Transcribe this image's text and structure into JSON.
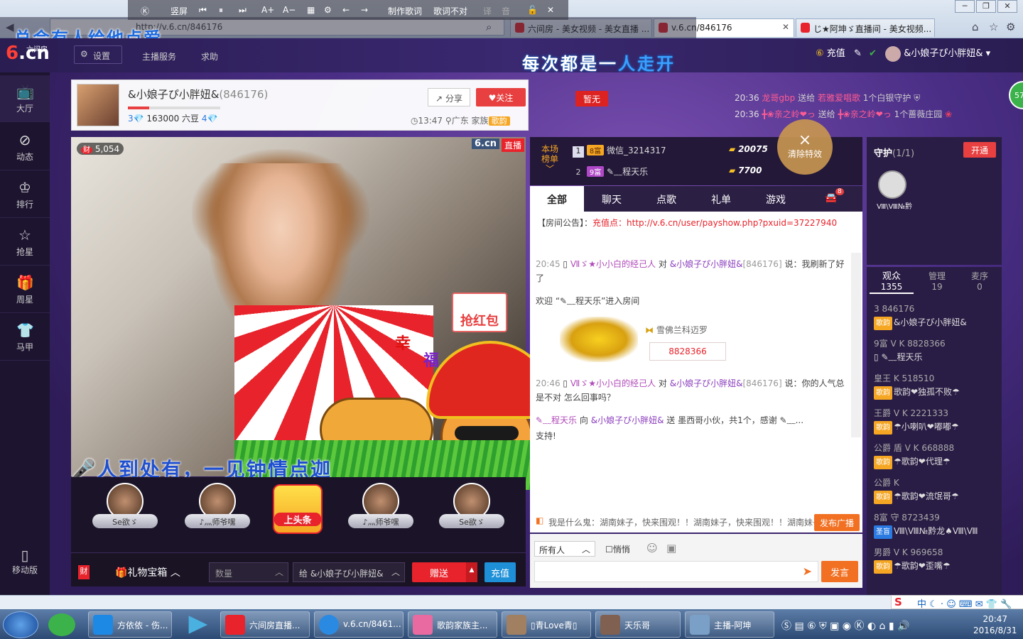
{
  "player_bar": {
    "items": [
      "竖屏",
      "制作歌词",
      "歌词不对",
      "译",
      "音"
    ]
  },
  "lyrics": {
    "line1": "总会有人给他点爱",
    "line2_a": "每次都是一",
    "line2_b": "人走开"
  },
  "browser": {
    "url": "http://v.6.cn/846176",
    "tabs": [
      {
        "label": "六间房 - 美女视频 - 美女直播 ..."
      },
      {
        "label": "v.6.cn/846176"
      },
      {
        "label": "じ★阿坤ゞ直播间 - 美女视频..."
      }
    ]
  },
  "site_nav": {
    "logo_text": "六间房",
    "logo": "6.cn",
    "settings": "设置",
    "anchor_service": "主播服务",
    "help": "求助",
    "recharge": "充值",
    "username": "&小娘子ぴ小胖妞&"
  },
  "sidebar": {
    "items": [
      {
        "label": "大厅",
        "icon": "tv-icon"
      },
      {
        "label": "动态",
        "icon": "compass-icon"
      },
      {
        "label": "排行",
        "icon": "crown-icon"
      },
      {
        "label": "抢星",
        "icon": "star-icon"
      },
      {
        "label": "周星",
        "icon": "gift-icon"
      },
      {
        "label": "马甲",
        "icon": "shirt-icon"
      }
    ],
    "mobile": "移动版"
  },
  "anchor": {
    "name": "&小娘子ぴ小胖妞&",
    "id": "(846176)",
    "beans": "163000 六豆",
    "level_left": "3",
    "level_right": "4",
    "share": "分享",
    "follow": "关注",
    "time": "13:47",
    "location": "广东",
    "family_label": "家族",
    "family_tag": "歌韵",
    "none_badge": "暂无"
  },
  "notices": [
    {
      "time": "20:36",
      "user": "龙哥gbp",
      "action": "送给",
      "target": "若雅爱唱歌",
      "gift": "1个白银守护"
    },
    {
      "time": "20:36",
      "user": "╋❀亲之岭❤っ",
      "action": "送给",
      "target": "╋❀亲之岭❤っ",
      "gift": "1个蔷薇庄园"
    }
  ],
  "video": {
    "wealth": "5,054",
    "wealth_icon": "财",
    "watermark": "6.cn",
    "live": "直播",
    "red_envelope": "抢红包",
    "luck1": "幸",
    "luck2": "福",
    "scroll_text": "人到处有，一见钟情点迦"
  },
  "seats": [
    {
      "name": "Se欲ゞ"
    },
    {
      "name": "♪灬师爷嘿"
    },
    {
      "name": "♪灬师爷嘿"
    },
    {
      "name": "Se欲ゞ"
    }
  ],
  "top_spot": "上头条",
  "gift_bar": {
    "cai": "财",
    "gift_box": "礼物宝箱",
    "qty_placeholder": "数量",
    "to": "给  &小娘子ぴ小胖妞&",
    "send": "赠送",
    "recharge": "充值"
  },
  "rank": {
    "label": "本场榜单",
    "rows": [
      {
        "rank": "1",
        "level": "8富",
        "name": "微信_3214317",
        "value": "20075"
      },
      {
        "rank": "2",
        "level": "9富",
        "name": "✎﹏程天乐",
        "value": "7700"
      }
    ]
  },
  "clear_effect": {
    "icon": "×",
    "label": "清除特效"
  },
  "chat_tabs": [
    {
      "label": "全部"
    },
    {
      "label": "聊天"
    },
    {
      "label": "点歌"
    },
    {
      "label": "礼单"
    },
    {
      "label": "游戏"
    }
  ],
  "car_badge": "8",
  "chat": {
    "announce_label": "【房间公告】：",
    "announce_text": "充值点：http://v.6.cn/user/payshow.php?pxuid=37227940",
    "messages": [
      {
        "time": "20:45",
        "user": "Ⅶゞ★小小白的经己人",
        "to": "对",
        "target": "&小娘子ぴ小胖妞&",
        "id": "[846176]",
        "text": "说：我刷新了好了"
      },
      {
        "text": "欢迎 “✎﹏程天乐”进入房间"
      },
      {
        "time": "20:46",
        "user": "Ⅶゞ★小小白的经己人",
        "to": "对",
        "target": "&小娘子ぴ小胖妞&",
        "id": "[846176]",
        "text": "说：你的人气总是不对 怎么回事吗？"
      },
      {
        "user": "✎﹏程天乐",
        "to": "向",
        "target": "&小娘子ぴ小胖妞&",
        "text": "送 墨西哥小伙，共1个，感谢 ✎﹏..."
      },
      {
        "text": "支持!"
      }
    ],
    "car_name": "雪佛兰科迈罗",
    "car_id": "8828366"
  },
  "broadcast": {
    "text": "我是什么鬼：湖南妹子，快来围观！！湖南妹子，快来围观！！湖南妹子",
    "button": "发布广播"
  },
  "input": {
    "audience": "所有人",
    "whisper": "悄悄",
    "send": "发言"
  },
  "guard": {
    "title": "守护",
    "count": "(1/1)",
    "open": "开通",
    "member": "Ⅷ\\Ⅷ№黔"
  },
  "viewer_tabs": [
    {
      "label": "观众",
      "count": "1355"
    },
    {
      "label": "管理",
      "count": "19"
    },
    {
      "label": "麦序",
      "count": "0"
    }
  ],
  "users": [
    {
      "line1": "3 846176",
      "line2": "&小娘子ぴ小胖妞&"
    },
    {
      "line1": "9富 V K 8828366",
      "line2": "✎﹏程天乐"
    },
    {
      "line1": "皇王 K 518510",
      "line2": "歌韵❤独孤不败☂"
    },
    {
      "line1": "王爵 V K 2221333",
      "line2": "☂小喇叭❤嘟嘟☂"
    },
    {
      "line1": "公爵 盾 V K 668888",
      "line2": "☂歌韵❤代理☂"
    },
    {
      "line1": "公爵 K",
      "line2": "☂歌韵❤流氓哥☂"
    },
    {
      "line1": "8富 守 8723439",
      "line2": "Ⅷ\\Ⅷ№黔龙♠Ⅷ\\Ⅷ"
    },
    {
      "line1": "男爵 V K 969658",
      "line2": "☂歌韵❤歪嘴☂"
    }
  ],
  "ring": "57",
  "taskbar": {
    "items": [
      {
        "label": "方依依 - 伤..."
      },
      {
        "label": "六间房直播..."
      },
      {
        "label": "v.6.cn/8461..."
      },
      {
        "label": "歌韵家族主..."
      },
      {
        "label": "▯青Love青▯"
      },
      {
        "label": "天乐哥"
      },
      {
        "label": "主播-阿坤"
      }
    ],
    "time": "20:47",
    "date": "2016/8/31",
    "ime": "中"
  }
}
